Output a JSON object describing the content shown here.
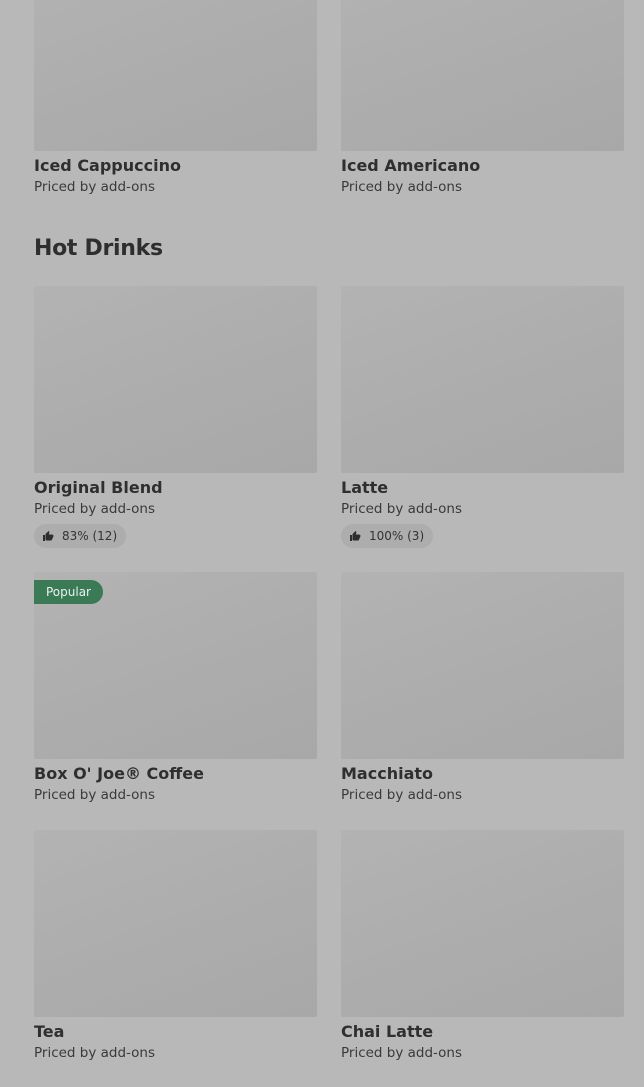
{
  "top_items": [
    {
      "name": "Iced Cappuccino",
      "price": "Priced by add-ons"
    },
    {
      "name": "Iced Americano",
      "price": "Priced by add-ons"
    }
  ],
  "section": {
    "title": "Hot Drinks",
    "items": [
      {
        "name": "Original Blend",
        "price": "Priced by add-ons",
        "rating": "83% (12)"
      },
      {
        "name": "Latte",
        "price": "Priced by add-ons",
        "rating": "100% (3)"
      },
      {
        "name": "Box O' Joe® Coffee",
        "price": "Priced by add-ons",
        "badge": "Popular"
      },
      {
        "name": "Macchiato",
        "price": "Priced by add-ons"
      },
      {
        "name": "Tea",
        "price": "Priced by add-ons"
      },
      {
        "name": "Chai Latte",
        "price": "Priced by add-ons"
      }
    ]
  },
  "colors": {
    "background": "#b8b8b8",
    "popular_badge": "#3a7b55",
    "rating_pill": "#adadad"
  }
}
